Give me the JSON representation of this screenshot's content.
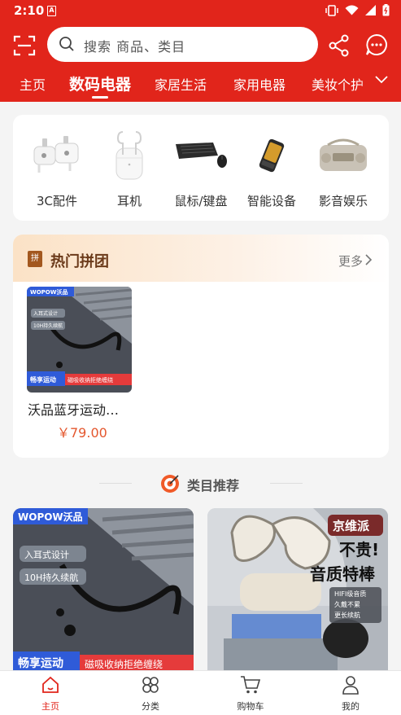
{
  "status": {
    "time": "2:10",
    "sim_label": "A"
  },
  "header": {
    "search_placeholder": "搜索 商品、类目"
  },
  "tabs": [
    "主页",
    "数码电器",
    "家居生活",
    "家用电器",
    "美妆个护"
  ],
  "categories": [
    {
      "label": "3C配件",
      "icon": "adapter-icon"
    },
    {
      "label": "耳机",
      "icon": "earbuds-icon"
    },
    {
      "label": "鼠标/键盘",
      "icon": "keyboard-icon"
    },
    {
      "label": "智能设备",
      "icon": "smart-device-icon"
    },
    {
      "label": "影音娱乐",
      "icon": "speaker-icon"
    }
  ],
  "group_buy": {
    "title": "热门拼团",
    "icon_char": "拼",
    "more": "更多",
    "product": {
      "name": "沃品蓝牙运动…",
      "price": "￥79.00",
      "brand": "WOPOW沃品",
      "tag1": "入耳式设计",
      "tag2": "10H持久续航",
      "banner_left": "畅享运动",
      "banner_right": "磁吸收纳拒绝缠绕"
    }
  },
  "recommend": {
    "title": "类目推荐"
  },
  "feed": [
    {
      "brand": "WOPOW沃品",
      "tag1": "入耳式设计",
      "tag2": "10H持久续航",
      "banner_left": "畅享运动",
      "banner_right": "磁吸收纳拒绝缠绕"
    },
    {
      "badge": "京维派",
      "headline1": "不贵!",
      "headline2": "音质特棒",
      "feature1": "HIFI级音质",
      "feature2": "久戴不累",
      "feature3": "更长续航"
    }
  ],
  "bottom_nav": [
    "主页",
    "分类",
    "购物车",
    "我的"
  ],
  "colors": {
    "brand_red": "#e1251b",
    "price_orange": "#e4572e"
  }
}
